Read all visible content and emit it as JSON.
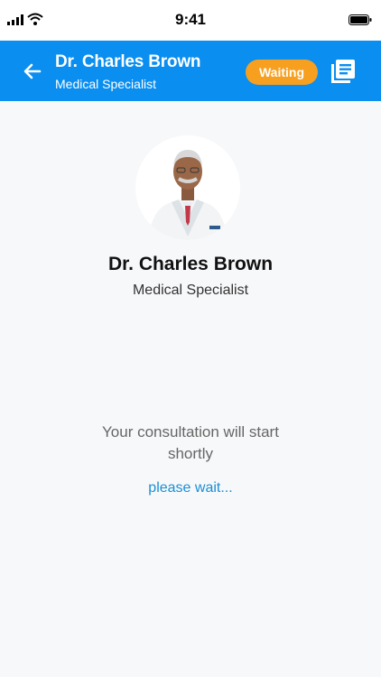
{
  "status_bar": {
    "time": "9:41"
  },
  "header": {
    "doctor_name": "Dr. Charles Brown",
    "doctor_role": "Medical Specialist",
    "status_badge": "Waiting",
    "accent_color": "#0a8ef0",
    "badge_color": "#f7a020"
  },
  "profile": {
    "name": "Dr. Charles Brown",
    "role": "Medical Specialist"
  },
  "consultation": {
    "message": "Your consultation will start shortly",
    "wait_text": "please wait..."
  },
  "icons": [
    "signal-icon",
    "wifi-icon",
    "battery-icon",
    "back-arrow-icon",
    "notes-icon"
  ]
}
